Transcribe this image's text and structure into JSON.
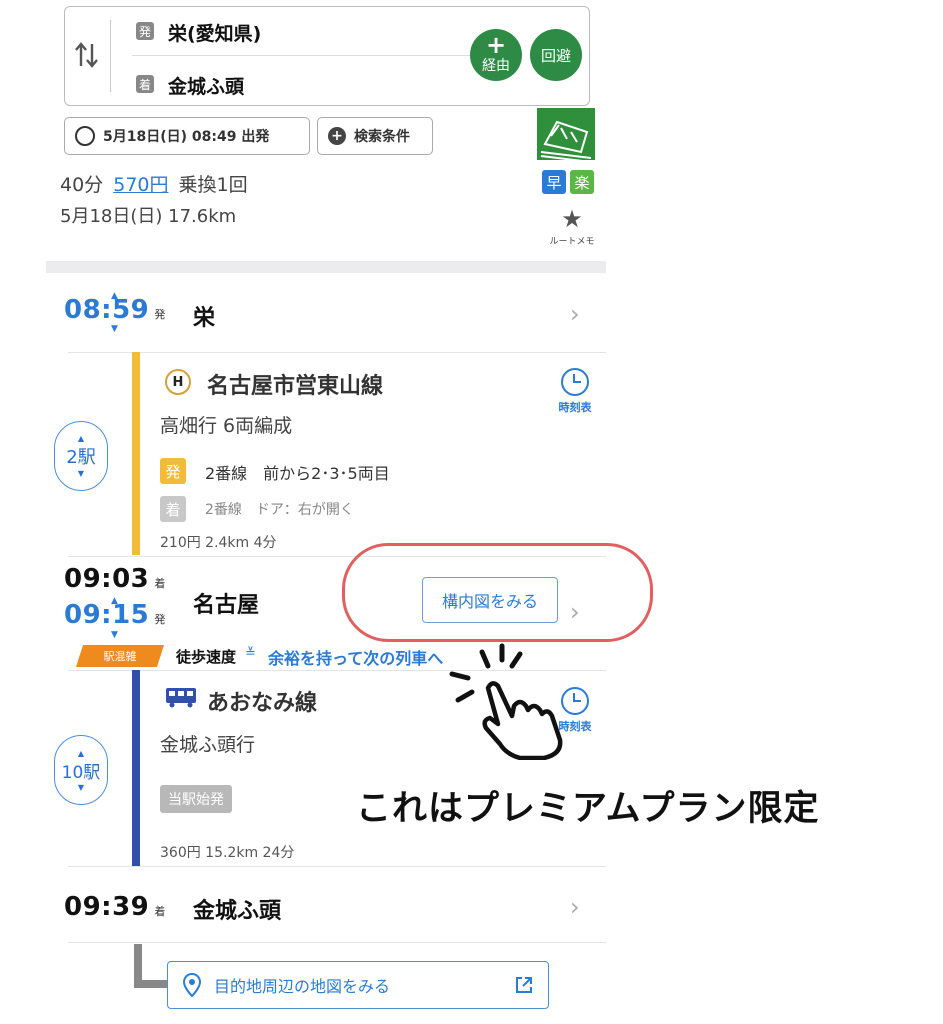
{
  "route": {
    "from_tag": "発",
    "from": "栄(愛知県)",
    "to_tag": "着",
    "to": "金城ふ頭",
    "via_label": "経由",
    "avoid_label": "回避",
    "datetime_label": "5月18日(日) 08:49 出発",
    "conditions_label": "検索条件"
  },
  "summary": {
    "duration": "40分",
    "fare": "570円",
    "transfers": "乗換1回",
    "date_distance": "5月18日(日) 17.6km",
    "badge_fast": "早",
    "badge_easy": "楽",
    "memo_label": "ルートメモ"
  },
  "stops": [
    {
      "time": "08:59",
      "suffix": "発",
      "name": "栄"
    },
    {
      "arr_time": "09:03",
      "arr_suffix": "着",
      "dep_time": "09:15",
      "dep_suffix": "発",
      "name": "名古屋",
      "map_button": "構内図をみる"
    },
    {
      "time": "09:39",
      "suffix": "着",
      "name": "金城ふ頭"
    }
  ],
  "legs": [
    {
      "line_name": "名古屋市営東山線",
      "line_icon_letter": "H",
      "direction": "高畑行 6両編成",
      "stop_count": "2駅",
      "dep_tag": "発",
      "dep_platform": "2番線　前から2･3･5両目",
      "arr_tag": "着",
      "arr_platform": "2番線　ドア：右が開く",
      "fare_info": "210円 2.4km 4分",
      "timetable_label": "時刻表"
    },
    {
      "line_name": "あおなみ線",
      "direction": "金城ふ頭行",
      "stop_count": "10駅",
      "origin_badge": "当駅始発",
      "fare_info": "360円 15.2km 24分",
      "timetable_label": "時刻表"
    }
  ],
  "transfer": {
    "congestion_badge": "駅混雑",
    "walk_label": "徒歩速度",
    "walk_link": "余裕を持って次の列車へ"
  },
  "destination_map_label": "目的地周辺の地図をみる",
  "annotation": {
    "text": "これはプレミアムプラン限定",
    "highlight_color": "#e0605f"
  },
  "colors": {
    "higashiyama_line": "#f2bb3a",
    "aonami_line": "#3350a8",
    "accent_blue": "#2a7bd5",
    "green_button": "#2e8b45"
  }
}
